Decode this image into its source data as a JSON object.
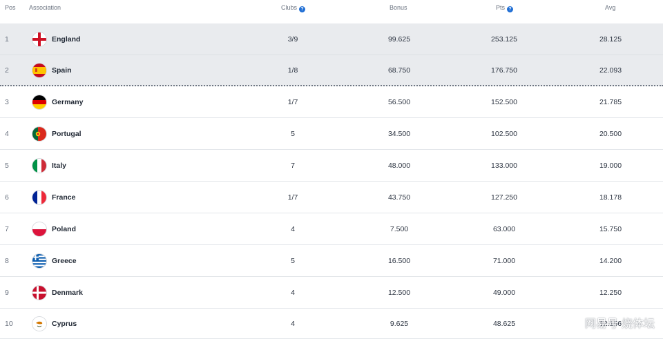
{
  "table": {
    "headers": {
      "pos": "Pos",
      "association": "Association",
      "clubs": "Clubs",
      "bonus": "Bonus",
      "pts": "Pts",
      "avg": "Avg"
    },
    "rows": [
      {
        "pos": "1",
        "name": "England",
        "clubs": "3/9",
        "bonus": "99.625",
        "pts": "253.125",
        "avg": "28.125",
        "flag": "england-flag-icon",
        "highlight": true
      },
      {
        "pos": "2",
        "name": "Spain",
        "clubs": "1/8",
        "bonus": "68.750",
        "pts": "176.750",
        "avg": "22.093",
        "flag": "spain-flag-icon",
        "highlight": true
      },
      {
        "pos": "3",
        "name": "Germany",
        "clubs": "1/7",
        "bonus": "56.500",
        "pts": "152.500",
        "avg": "21.785",
        "flag": "germany-flag-icon",
        "highlight": false
      },
      {
        "pos": "4",
        "name": "Portugal",
        "clubs": "5",
        "bonus": "34.500",
        "pts": "102.500",
        "avg": "20.500",
        "flag": "portugal-flag-icon",
        "highlight": false
      },
      {
        "pos": "5",
        "name": "Italy",
        "clubs": "7",
        "bonus": "48.000",
        "pts": "133.000",
        "avg": "19.000",
        "flag": "italy-flag-icon",
        "highlight": false
      },
      {
        "pos": "6",
        "name": "France",
        "clubs": "1/7",
        "bonus": "43.750",
        "pts": "127.250",
        "avg": "18.178",
        "flag": "france-flag-icon",
        "highlight": false
      },
      {
        "pos": "7",
        "name": "Poland",
        "clubs": "4",
        "bonus": "7.500",
        "pts": "63.000",
        "avg": "15.750",
        "flag": "poland-flag-icon",
        "highlight": false
      },
      {
        "pos": "8",
        "name": "Greece",
        "clubs": "5",
        "bonus": "16.500",
        "pts": "71.000",
        "avg": "14.200",
        "flag": "greece-flag-icon",
        "highlight": false
      },
      {
        "pos": "9",
        "name": "Denmark",
        "clubs": "4",
        "bonus": "12.500",
        "pts": "49.000",
        "avg": "12.250",
        "flag": "denmark-flag-icon",
        "highlight": false
      },
      {
        "pos": "10",
        "name": "Cyprus",
        "clubs": "4",
        "bonus": "9.625",
        "pts": "48.625",
        "avg": "12.156",
        "flag": "cyprus-flag-icon",
        "highlight": false
      }
    ]
  },
  "watermark": "网易号 烧体坛",
  "colors": {
    "highlight_bg": "#e9ebee",
    "help_icon": "#1f6ed4",
    "divider": "#e3e6ea"
  }
}
